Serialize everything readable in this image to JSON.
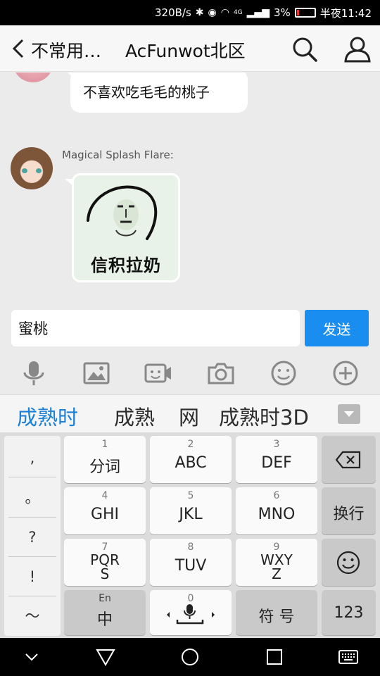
{
  "status_bar": {
    "net_speed": "320B/s",
    "signal": "4G",
    "battery": "3%",
    "time": "半夜11:42"
  },
  "header": {
    "back_label": "不常用…",
    "title": "AcFunwot北区"
  },
  "chat": {
    "message1": "不喜欢吃毛毛的桃子",
    "sender2": "Magical Splash Flare:",
    "sticker_caption": "信积拉奶"
  },
  "composer": {
    "input_value": "蜜桃",
    "send_label": "发送"
  },
  "candidates": [
    "成熟时",
    "成熟",
    "网",
    "成熟时3D"
  ],
  "keyboard": {
    "punctuation": [
      ",",
      "。",
      "?",
      "!",
      "～"
    ],
    "keys": [
      {
        "num": "1",
        "label": "分词"
      },
      {
        "num": "2",
        "label": "ABC"
      },
      {
        "num": "3",
        "label": "DEF"
      },
      {
        "num": "4",
        "label": "GHI"
      },
      {
        "num": "5",
        "label": "JKL"
      },
      {
        "num": "6",
        "label": "MNO"
      },
      {
        "num": "7",
        "label": "PQR\nS"
      },
      {
        "num": "8",
        "label": "TUV"
      },
      {
        "num": "9",
        "label": "WXY\nZ"
      }
    ],
    "newline_label": "换行",
    "lang_top": "En",
    "lang_bottom": "中",
    "space_num": "0",
    "symbol_label": "符 号",
    "numeric_label": "123"
  },
  "icons": [
    "back-arrow",
    "search",
    "group",
    "microphone",
    "image",
    "video",
    "camera",
    "emoji",
    "plus",
    "backspace",
    "smiley",
    "collapse",
    "nav-back",
    "nav-home",
    "nav-recents",
    "nav-keyboard"
  ]
}
